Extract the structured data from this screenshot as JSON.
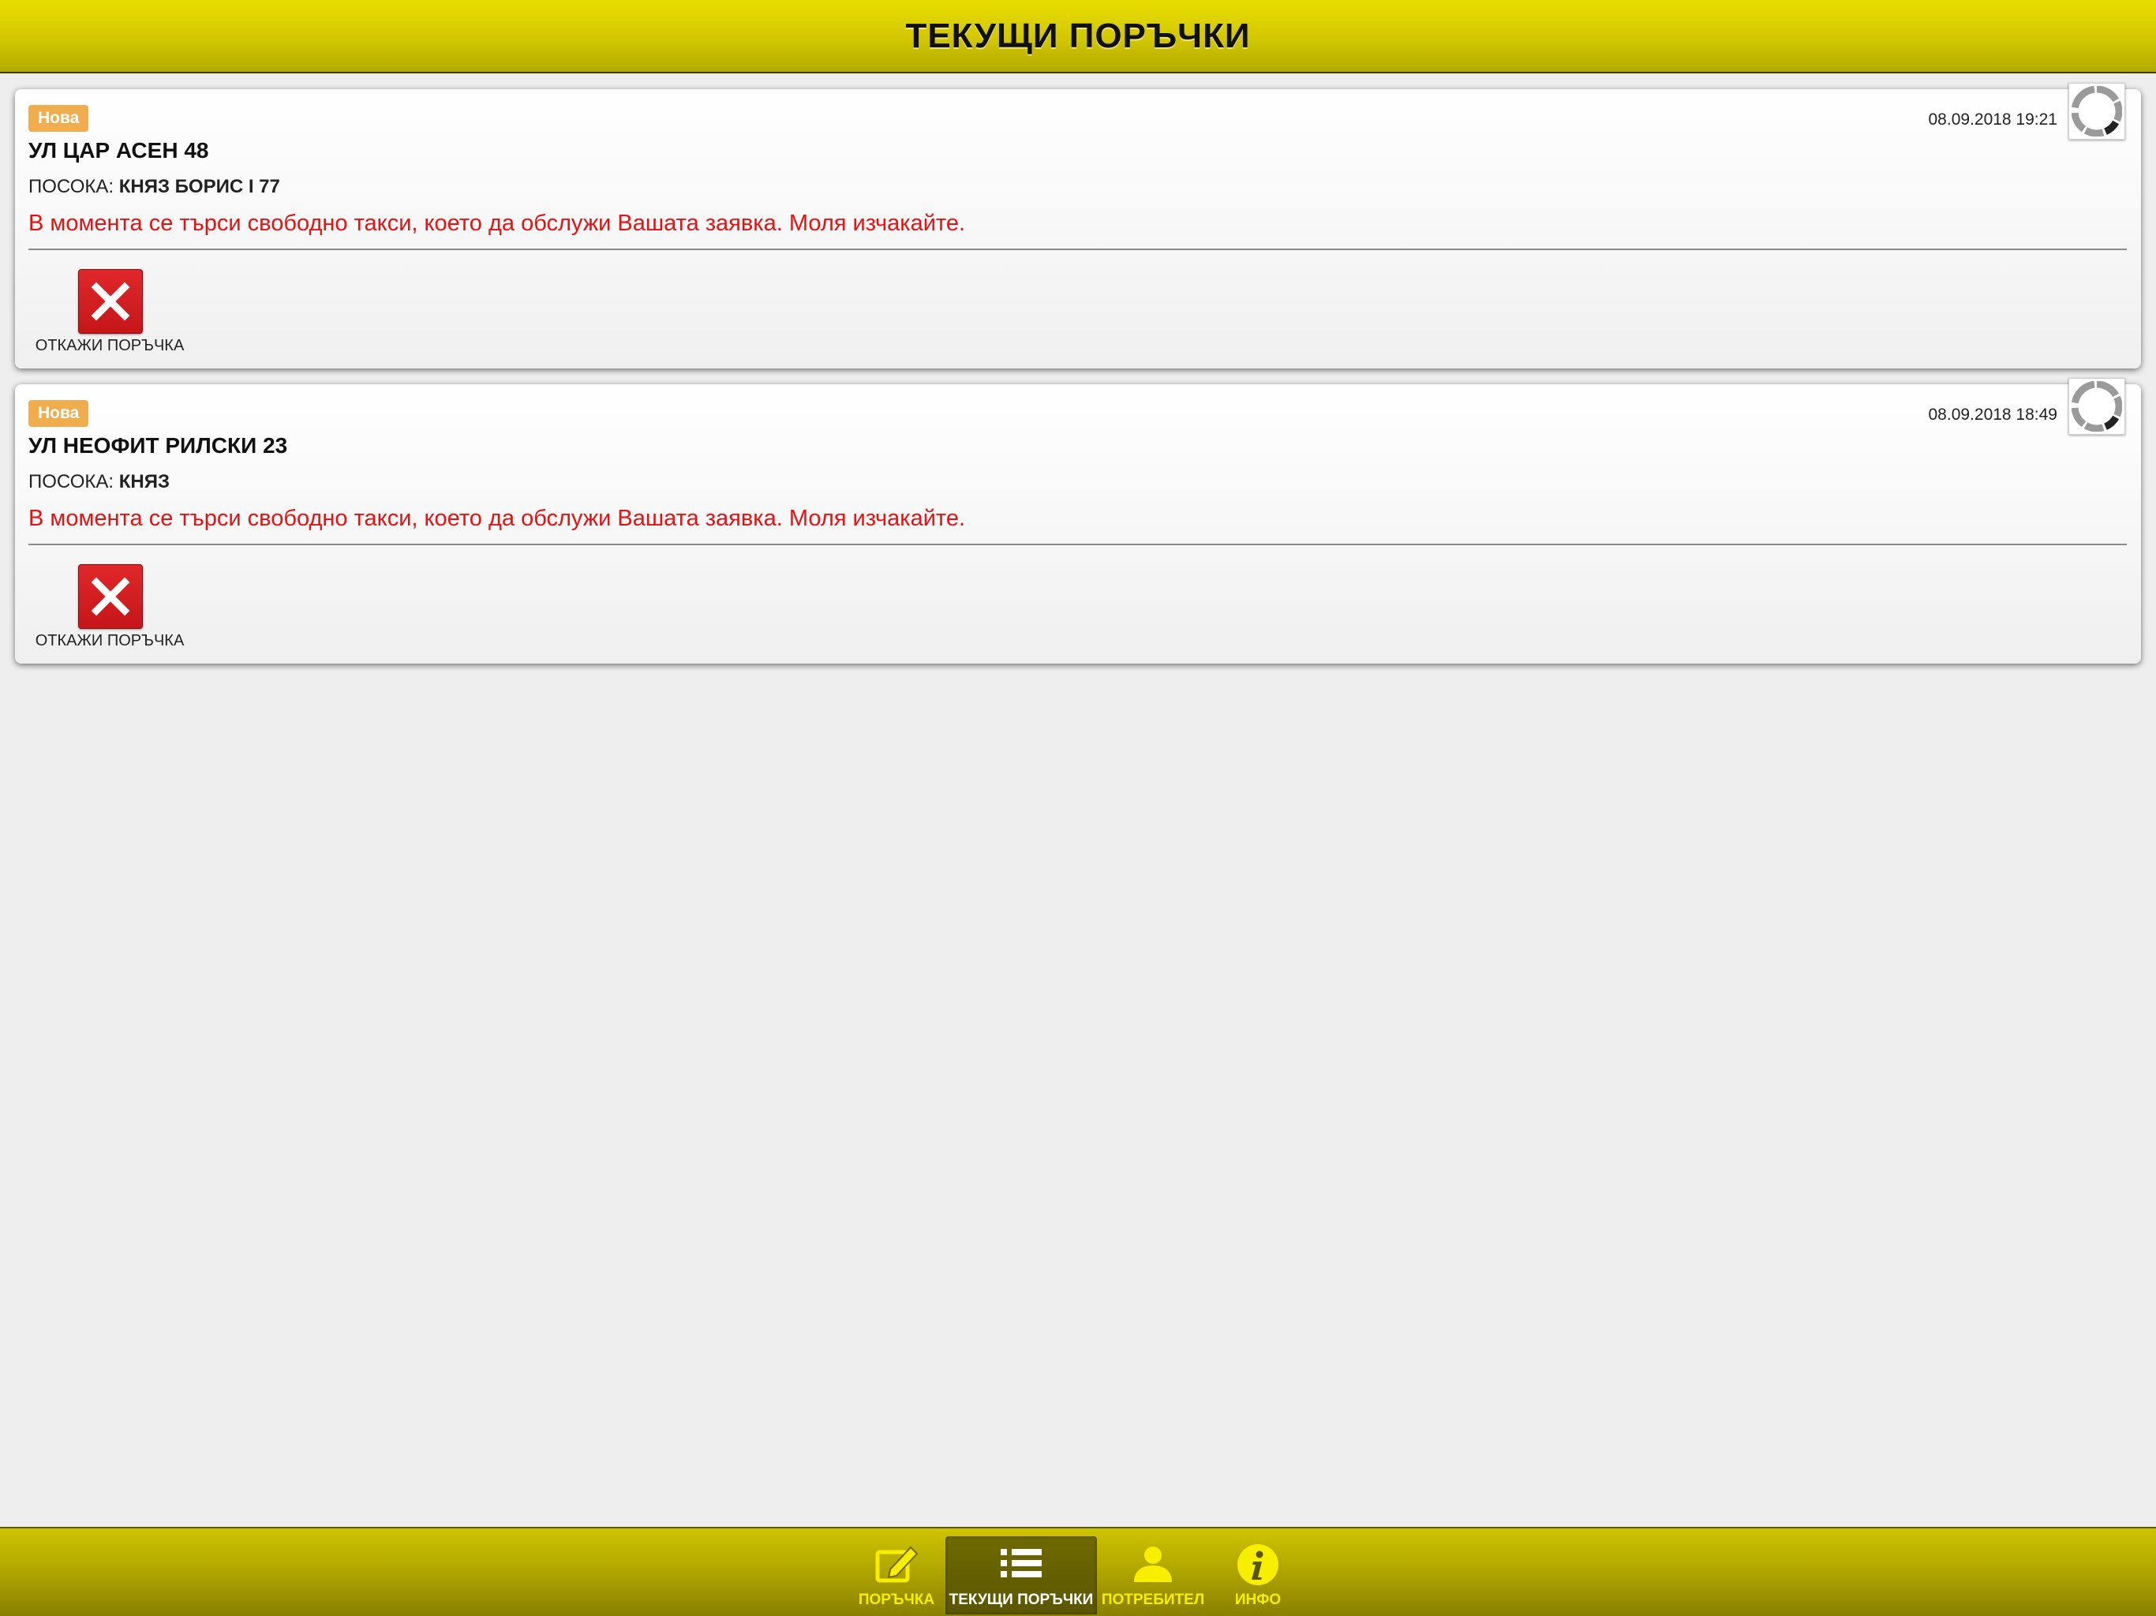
{
  "header": {
    "title": "ТЕКУЩИ ПОРЪЧКИ"
  },
  "orders": [
    {
      "status_badge": "Нова",
      "timestamp": "08.09.2018 19:21",
      "address": "УЛ ЦАР АСЕН 48",
      "direction_label": "ПОСОКА:",
      "direction_value": "КНЯЗ БОРИС I 77",
      "message": "В момента се търси свободно такси, което да обслужи Вашата заявка. Моля изчакайте.",
      "cancel_label": "ОТКАЖИ ПОРЪЧКА"
    },
    {
      "status_badge": "Нова",
      "timestamp": "08.09.2018 18:49",
      "address": "УЛ НЕОФИТ РИЛСКИ 23",
      "direction_label": "ПОСОКА:",
      "direction_value": "КНЯЗ",
      "message": "В момента се търси свободно такси, което да обслужи Вашата заявка. Моля изчакайте.",
      "cancel_label": "ОТКАЖИ ПОРЪЧКА"
    }
  ],
  "tabbar": {
    "items": [
      {
        "label": "ПОРЪЧКА",
        "icon": "edit-icon",
        "active": false
      },
      {
        "label": "ТЕКУЩИ ПОРЪЧКИ",
        "icon": "list-icon",
        "active": true
      },
      {
        "label": "ПОТРЕБИТЕЛ",
        "icon": "user-icon",
        "active": false
      },
      {
        "label": "ИНФО",
        "icon": "info-icon",
        "active": false
      }
    ]
  },
  "colors": {
    "header_yellow": "#d2c700",
    "badge_orange": "#f0ad4e",
    "message_red": "#e81111",
    "cancel_red": "#d21f21",
    "tab_label_yellow": "#f7ee00"
  }
}
